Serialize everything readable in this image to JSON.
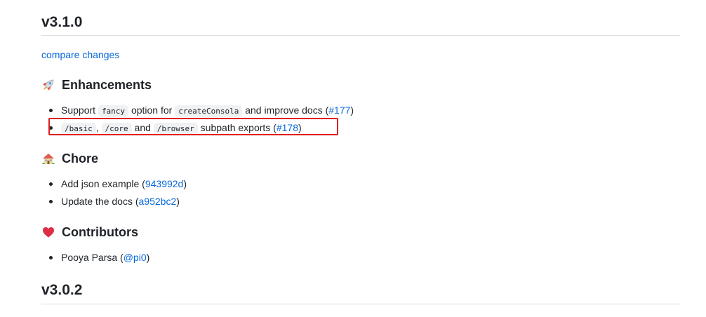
{
  "release_current": {
    "title": "v3.1.0",
    "compare_link": "compare changes"
  },
  "sections": {
    "enhancements": {
      "title": "Enhancements",
      "icon": "rocket-icon",
      "items": [
        {
          "pre": "Support",
          "code1": "fancy",
          "mid": "option for",
          "code2": "createConsola",
          "post": "and improve docs (",
          "ref": "#177",
          "close": ")"
        },
        {
          "code1": "/basic",
          "sep1": ",",
          "code2": "/core",
          "sep2": "and",
          "code3": "/browser",
          "post": "subpath exports (",
          "ref": "#178",
          "close": ")"
        }
      ]
    },
    "chore": {
      "title": "Chore",
      "icon": "house-with-garden-icon",
      "items": [
        {
          "text": "Add json example (",
          "ref": "943992d",
          "close": ")"
        },
        {
          "text": "Update the docs (",
          "ref": "a952bc2",
          "close": ")"
        }
      ]
    },
    "contributors": {
      "title": "Contributors",
      "icon": "red-heart-icon",
      "items": [
        {
          "text": "Pooya Parsa (",
          "ref": "@pi0",
          "close": ")"
        }
      ]
    }
  },
  "release_next": {
    "title": "v3.0.2"
  },
  "colors": {
    "link": "#0969da",
    "text": "#1f2328",
    "highlight": "#e0201b"
  }
}
